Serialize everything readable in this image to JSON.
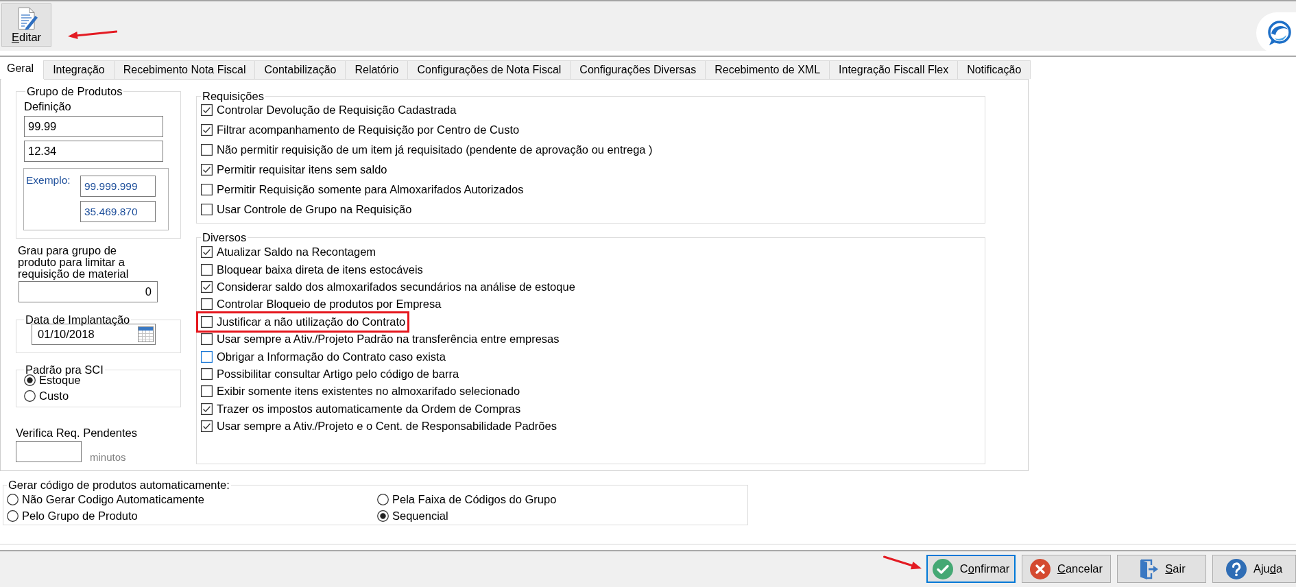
{
  "toolbar": {
    "buttons": [
      {
        "kind": "edit",
        "access_key": "E",
        "text_after_key": "ditar",
        "annotated": true
      }
    ]
  },
  "tabs": [
    {
      "label": "Geral",
      "selected": true
    },
    {
      "label": "Integração",
      "selected": false
    },
    {
      "label": "Recebimento Nota Fiscal",
      "selected": false
    },
    {
      "label": "Contabilização",
      "selected": false
    },
    {
      "label": "Relatório",
      "selected": false
    },
    {
      "label": "Configurações de Nota Fiscal",
      "selected": false
    },
    {
      "label": "Configurações Diversas",
      "selected": false
    },
    {
      "label": "Recebimento de XML",
      "selected": false
    },
    {
      "label": "Integração Fiscall Flex",
      "selected": false
    },
    {
      "label": "Notificação",
      "selected": false
    }
  ],
  "product_group": {
    "title": "Grupo de Produtos",
    "definition_label": "Definição",
    "definition_values": [
      "99.99",
      "12.34"
    ],
    "example_label": "Exemplo:",
    "example_values": [
      "99.999.999",
      "35.469.870"
    ]
  },
  "group_level": {
    "label": "Grau para grupo de produto para limitar a requisição de material",
    "value": "0"
  },
  "implementation_date": {
    "title": "Data de Implantação",
    "value": "01/10/2018"
  },
  "sci_default": {
    "title": "Padrão pra SCI",
    "options": [
      {
        "label": "Estoque",
        "selected": true
      },
      {
        "label": "Custo",
        "selected": false
      }
    ]
  },
  "pending_requests": {
    "label": "Verifica Req. Pendentes",
    "unit": "minutos"
  },
  "requisicoes": {
    "title": "Requisições",
    "items": [
      {
        "label": "Controlar Devolução de Requisição Cadastrada",
        "checked": true
      },
      {
        "label": "Filtrar acompanhamento de Requisição por Centro de Custo",
        "checked": true
      },
      {
        "label": "Não permitir requisição de um item já requisitado (pendente de aprovação ou entrega )",
        "checked": false
      },
      {
        "label": "Permitir requisitar itens sem saldo",
        "checked": true
      },
      {
        "label": "Permitir Requisição somente para Almoxarifados Autorizados",
        "checked": false
      },
      {
        "label": "Usar Controle de Grupo na Requisição",
        "checked": false
      }
    ]
  },
  "diversos": {
    "title": "Diversos",
    "items": [
      {
        "label": "Atualizar Saldo na Recontagem",
        "checked": true,
        "focused": false,
        "annotated": false
      },
      {
        "label": "Bloquear baixa direta de itens estocáveis",
        "checked": false,
        "focused": false,
        "annotated": false
      },
      {
        "label": "Considerar saldo dos almoxarifados secundários na análise de estoque",
        "checked": true,
        "focused": false,
        "annotated": false
      },
      {
        "label": "Controlar Bloqueio de produtos por Empresa",
        "checked": false,
        "focused": false,
        "annotated": false
      },
      {
        "label": "Justificar a não utilização do Contrato",
        "checked": false,
        "focused": false,
        "annotated": true
      },
      {
        "label": "Usar sempre a Ativ./Projeto Padrão na transferência entre empresas",
        "checked": false,
        "focused": false,
        "annotated": false
      },
      {
        "label": "Obrigar a Informação do Contrato caso exista",
        "checked": false,
        "focused": true,
        "annotated": false
      },
      {
        "label": "Possibilitar consultar Artigo pelo código de barra",
        "checked": false,
        "focused": false,
        "annotated": false
      },
      {
        "label": "Exibir somente itens existentes no almoxarifado selecionado",
        "checked": false,
        "focused": false,
        "annotated": false
      },
      {
        "label": "Trazer os impostos automaticamente da Ordem de Compras",
        "checked": true,
        "focused": false,
        "annotated": false
      },
      {
        "label": "Usar sempre a Ativ./Projeto e o Cent. de Responsabilidade Padrões",
        "checked": true,
        "focused": false,
        "annotated": false
      }
    ]
  },
  "code_generation": {
    "title": "Gerar código de produtos automaticamente:",
    "options": [
      {
        "label": "Não Gerar Codigo Automaticamente",
        "selected": false
      },
      {
        "label": "Pela Faixa de Códigos do Grupo",
        "selected": false
      },
      {
        "label": "Pelo Grupo de Produto",
        "selected": false
      },
      {
        "label": "Sequencial",
        "selected": true
      }
    ]
  },
  "footer_buttons": [
    {
      "kind": "confirm",
      "text_before_key": "C",
      "access_key": "o",
      "text_after_key": "nfirmar",
      "focused": true,
      "annotated": true
    },
    {
      "kind": "cancel",
      "access_key": "C",
      "text_after_key": "ancelar",
      "focused": false,
      "annotated": false
    },
    {
      "kind": "exit",
      "access_key": "S",
      "text_after_key": "air",
      "focused": false,
      "annotated": false
    },
    {
      "kind": "help",
      "text_before_key": "Aju",
      "access_key": "d",
      "text_after_key": "a",
      "focused": false,
      "annotated": false
    }
  ]
}
